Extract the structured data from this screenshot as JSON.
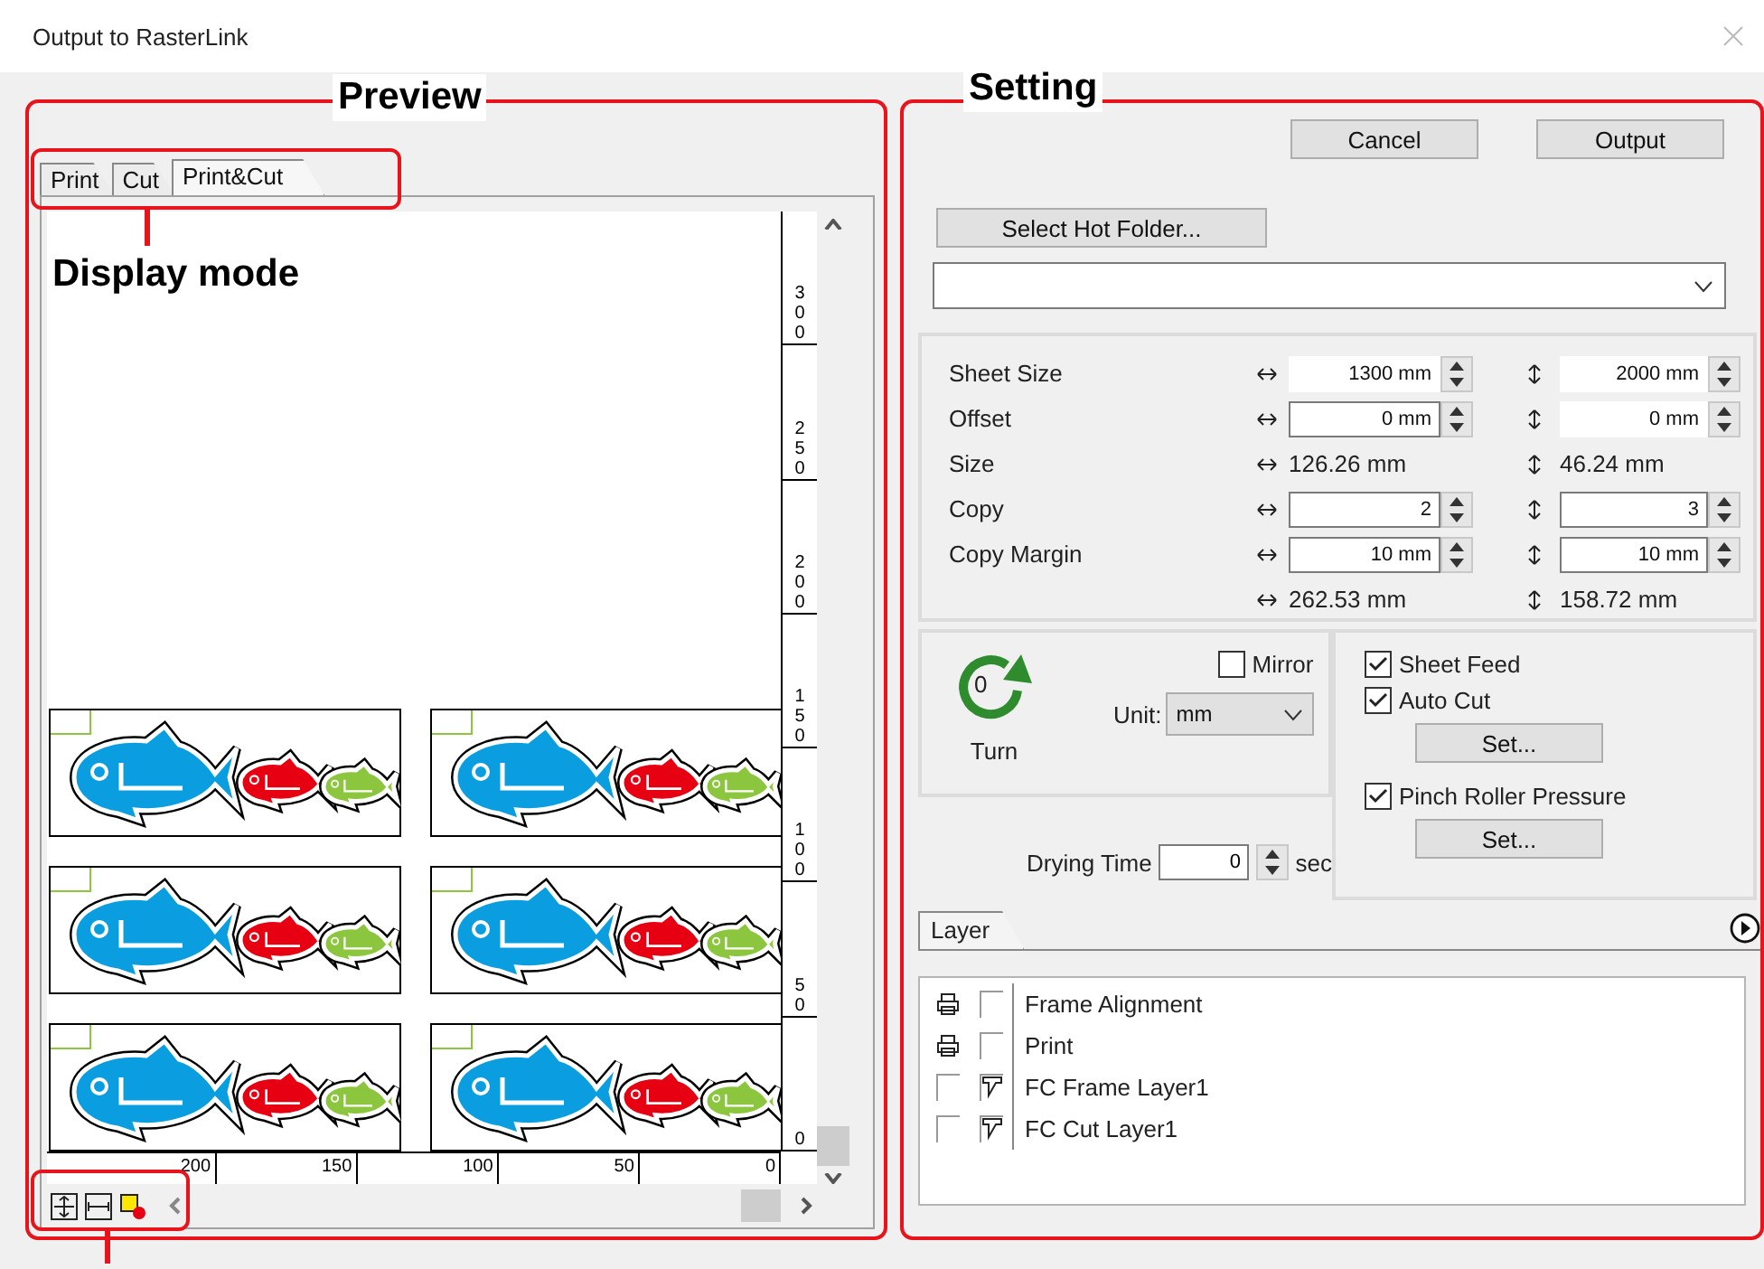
{
  "window": {
    "title": "Output to RasterLink"
  },
  "annotations": {
    "preview": "Preview",
    "setting": "Setting",
    "display_mode": "Display mode"
  },
  "preview": {
    "tabs": [
      {
        "label": "Print",
        "selected": false
      },
      {
        "label": "Cut",
        "selected": false
      },
      {
        "label": "Print&Cut",
        "selected": true
      }
    ],
    "ruler": {
      "vertical": [
        "300",
        "250",
        "200",
        "150",
        "100",
        "50",
        "0"
      ],
      "horizontal": [
        "200",
        "150",
        "100",
        "50",
        "0"
      ]
    }
  },
  "setting": {
    "buttons": [
      "Cancel",
      "Output"
    ],
    "hot_folder_button": "Select Hot Folder...",
    "rows": [
      {
        "label": "Sheet Size",
        "kind": "spin",
        "x": {
          "value": "1300 mm",
          "editable": false
        },
        "y": {
          "value": "2000 mm",
          "editable": false
        }
      },
      {
        "label": "Offset",
        "kind": "spin",
        "x": {
          "value": "0 mm",
          "editable": true
        },
        "y": {
          "value": "0 mm",
          "editable": false
        }
      },
      {
        "label": "Size",
        "kind": "readout",
        "x": "126.26 mm",
        "y": "46.24 mm"
      },
      {
        "label": "Copy",
        "kind": "spin",
        "x": {
          "value": "2",
          "editable": true
        },
        "y": {
          "value": "3",
          "editable": true
        }
      },
      {
        "label": "Copy Margin",
        "kind": "spin",
        "x": {
          "value": "10 mm",
          "editable": true
        },
        "y": {
          "value": "10 mm",
          "editable": true
        }
      },
      {
        "kind": "readout",
        "x": "262.53 mm",
        "y": "158.72 mm"
      }
    ],
    "turn": {
      "value": "0",
      "label": "Turn"
    },
    "mirror": {
      "label": "Mirror",
      "checked": false
    },
    "unit": {
      "label": "Unit:",
      "value": "mm"
    },
    "options": [
      {
        "kind": "check",
        "label": "Sheet Feed",
        "checked": true
      },
      {
        "kind": "check",
        "label": "Auto Cut",
        "checked": true
      },
      {
        "kind": "button",
        "label": "Set..."
      },
      {
        "kind": "check",
        "label": "Pinch Roller Pressure",
        "checked": true
      },
      {
        "kind": "button",
        "label": "Set..."
      }
    ],
    "drying": {
      "label": "Drying Time",
      "value": "0",
      "unit": "sec"
    },
    "layer_panel": {
      "tab": {
        "label": "Layer",
        "selected": true
      },
      "layers": [
        {
          "name": "Frame Alignment",
          "print": true,
          "cut": false
        },
        {
          "name": "Print",
          "print": true,
          "cut": false
        },
        {
          "name": "FC Frame Layer1",
          "print": false,
          "cut": true
        },
        {
          "name": "FC Cut Layer1",
          "print": false,
          "cut": true
        }
      ]
    }
  }
}
